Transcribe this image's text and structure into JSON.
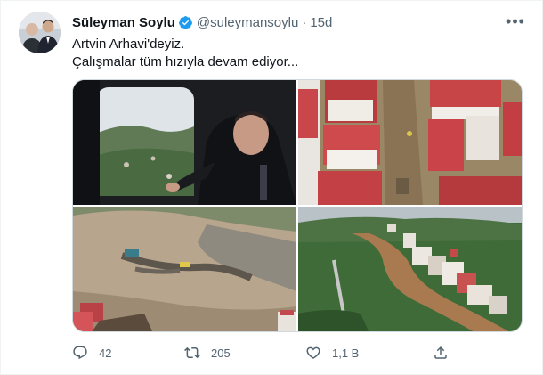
{
  "tweet": {
    "author_name": "Süleyman Soylu",
    "handle": "@suleymansoylu",
    "separator": "·",
    "time": "15d",
    "more_label": "•••",
    "text_lines": [
      "Artvin Arhavi'deyiz.",
      "Çalışmalar tüm hızıyla devam ediyor..."
    ],
    "media": [
      {
        "icon": "photo-helicopter-window"
      },
      {
        "icon": "photo-aerial-flooded-street"
      },
      {
        "icon": "photo-aerial-flood-bank"
      },
      {
        "icon": "photo-aerial-river-valley"
      }
    ],
    "actions": {
      "reply_count": "42",
      "retweet_count": "205",
      "like_count": "1,1 B"
    }
  },
  "colors": {
    "verified": "#1d9bf0",
    "text_primary": "#0f1419",
    "text_secondary": "#536471",
    "border": "#cfd9de"
  }
}
